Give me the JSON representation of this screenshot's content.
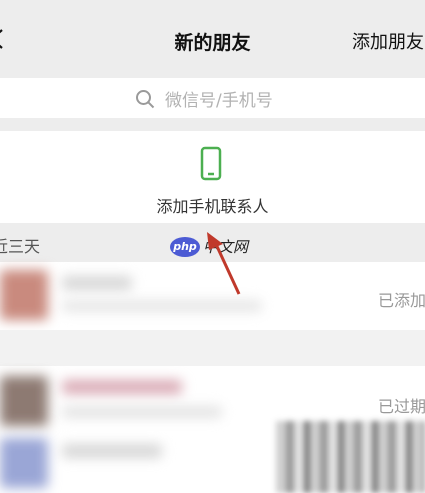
{
  "header": {
    "title": "新的朋友",
    "add_friend_label": "添加朋友"
  },
  "search": {
    "placeholder": "微信号/手机号"
  },
  "contacts_entry": {
    "label": "添加手机联系人",
    "icon": "phone-icon",
    "icon_color": "#4caf50"
  },
  "section": {
    "label": "近三天"
  },
  "requests": [
    {
      "status": "已添加"
    },
    {
      "status": "已过期"
    }
  ],
  "watermark": {
    "badge": "php",
    "text": "中文网"
  },
  "colors": {
    "background": "#ededed",
    "panel": "#ffffff",
    "accent_green": "#4caf50",
    "arrow_red": "#c0392b"
  }
}
